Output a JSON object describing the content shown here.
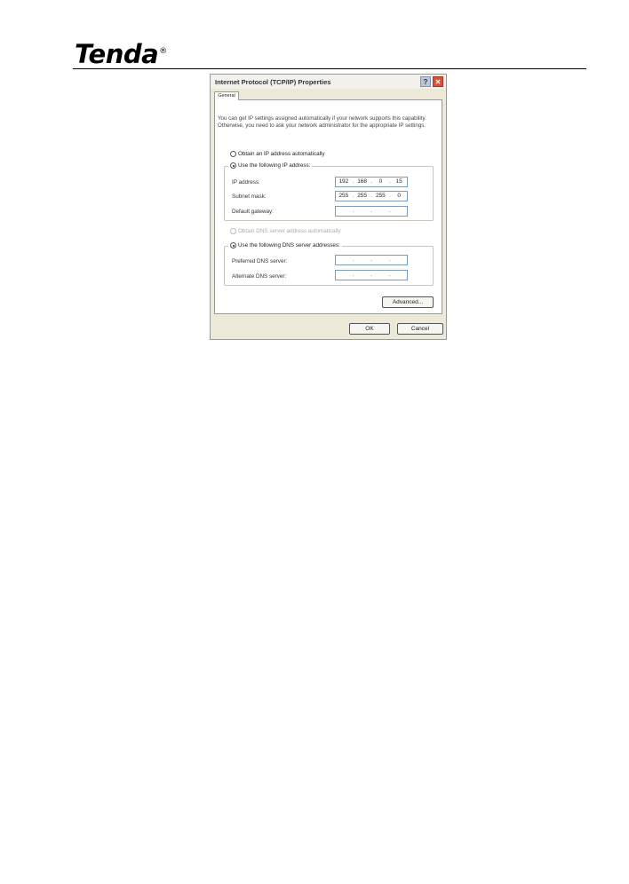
{
  "brand": {
    "logo_text": "Tenda",
    "registered_mark": "®"
  },
  "dialog": {
    "title": "Internet Protocol (TCP/IP) Properties",
    "help_label": "?",
    "close_label": "✕",
    "tab_general": "General",
    "intro_text": "You can get IP settings assigned automatically if your network supports this capability. Otherwise, you need to ask your network administrator for the appropriate IP settings.",
    "radio_auto_ip": "Obtain an IP address automatically",
    "radio_manual_ip": "Use the following IP address:",
    "ip_address_label": "IP address:",
    "ip_address": [
      "192",
      "168",
      "0",
      "15"
    ],
    "subnet_mask_label": "Subnet mask:",
    "subnet_mask": [
      "255",
      "255",
      "255",
      "0"
    ],
    "default_gateway_label": "Default gateway:",
    "default_gateway": [
      "",
      "",
      "",
      ""
    ],
    "radio_auto_dns": "Obtain DNS server address automatically",
    "radio_manual_dns": "Use the following DNS server addresses:",
    "preferred_dns_label": "Preferred DNS server:",
    "preferred_dns": [
      "",
      "",
      "",
      ""
    ],
    "alternate_dns_label": "Alternate DNS server:",
    "alternate_dns": [
      "",
      "",
      "",
      ""
    ],
    "advanced_button": "Advanced...",
    "ok_button": "OK",
    "cancel_button": "Cancel"
  }
}
